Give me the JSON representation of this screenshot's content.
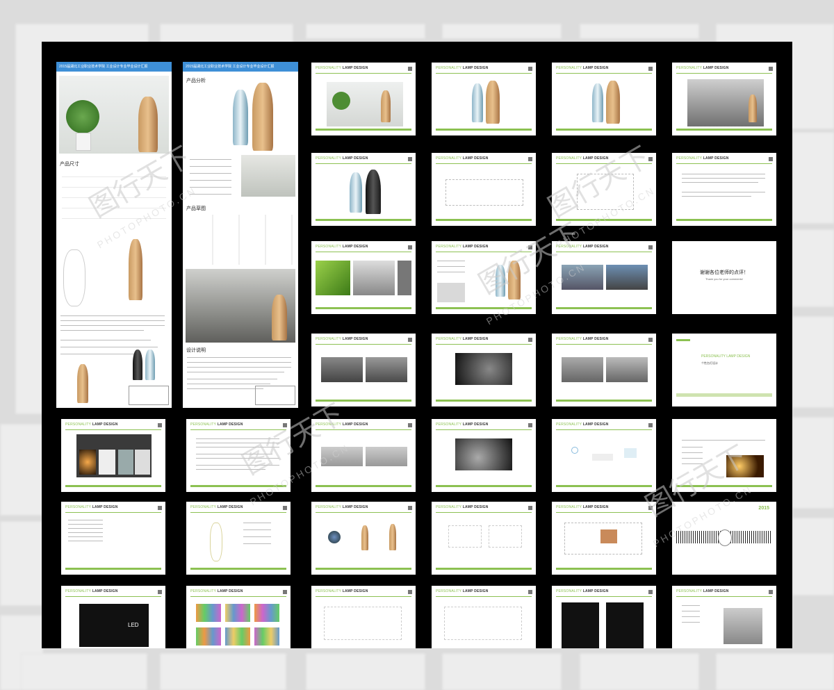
{
  "header_text": "PERSONALITY",
  "header_strong": "LAMP DESIGN",
  "posters": {
    "left_title": "2015届湖北工业职业技术学院 工业设计专业毕业设计汇报",
    "right_title": "2015届湖北工业职业技术学院 工业设计专业毕业设计汇报",
    "left_section1": "产品尺寸",
    "right_section1": "产品分析",
    "right_section2": "产品草图",
    "right_section3": "设计说明"
  },
  "slides": {
    "thanks_title": "谢谢各位老师的点评！",
    "thanks_sub": "Thank you for your comments!",
    "cover_title": "PERSONALITY LAMP DESIGN",
    "cover_sub": "个性台灯设计",
    "year": "2015",
    "led_label": "LED"
  },
  "watermark": {
    "main": "图行天下",
    "sub": "PHOTOPHOTO.CN"
  }
}
